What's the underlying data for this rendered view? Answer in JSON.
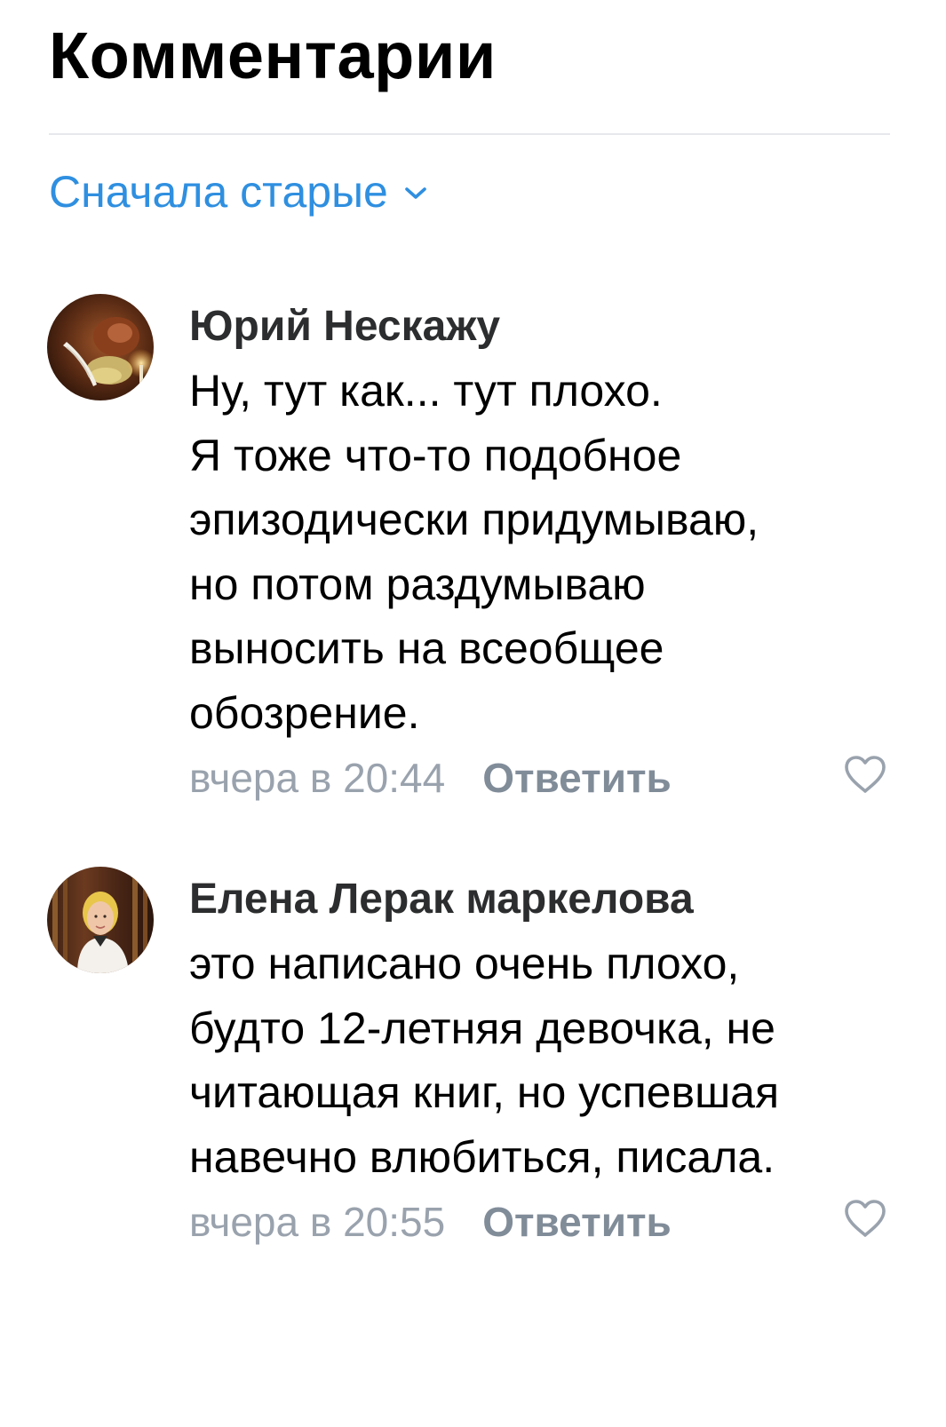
{
  "header": {
    "title": "Комментарии"
  },
  "sort": {
    "label": "Сначала старые",
    "icon": "chevron-down-icon",
    "color": "#2f8fe0"
  },
  "comments": [
    {
      "author": "Юрий Нескажу",
      "avatar": "avatar-feather-candle",
      "text_lines": [
        "Ну, тут как... тут плохо.",
        "Я тоже что-то подобное",
        "эпизодически придумываю,",
        "но потом раздумываю",
        "выносить на всеобщее",
        "обозрение."
      ],
      "date": "вчера в 20:44",
      "reply_label": "Ответить",
      "like_icon": "heart-icon"
    },
    {
      "author": "Елена Лерак маркелова",
      "avatar": "avatar-woman-portrait",
      "text_lines": [
        "это написано очень плохо,",
        "будто 12-летняя девочка, не",
        "читающая книг, но успевшая",
        "навечно влюбиться, писала."
      ],
      "date": "вчера в 20:55",
      "reply_label": "Ответить",
      "like_icon": "heart-icon"
    }
  ]
}
